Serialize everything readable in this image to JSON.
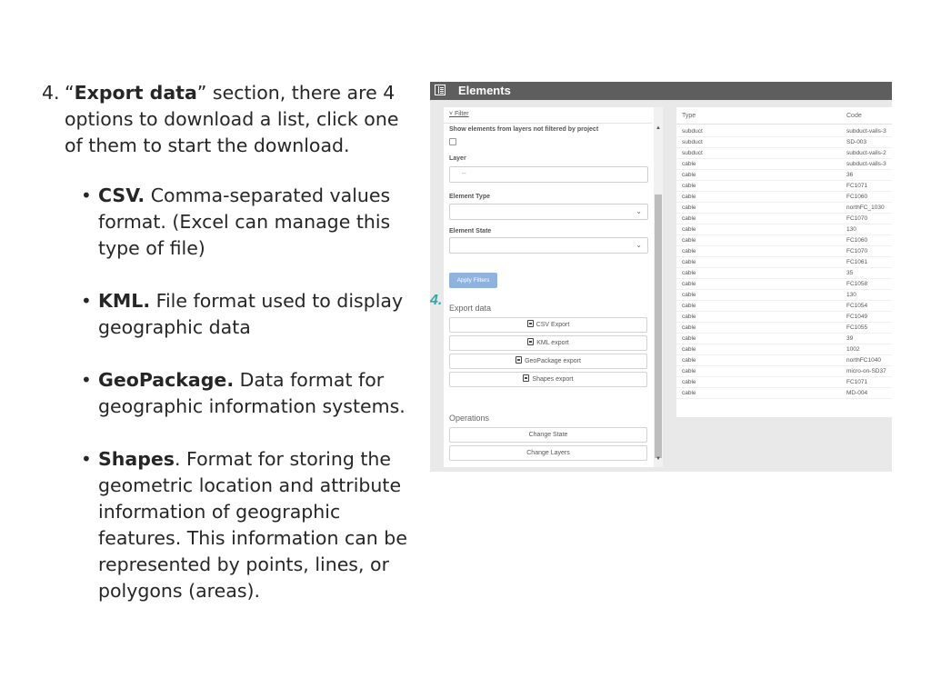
{
  "doc": {
    "step_number": "4.",
    "intro_open_quote": "“",
    "intro_bold": "Export data",
    "intro_rest": "” section, there are 4 options to download a list, click one of them to start the download.",
    "bullets": [
      {
        "term": "CSV.",
        "text": " Comma-separated values format. (Excel can manage this type of file)"
      },
      {
        "term": "KML.",
        "text": " File format used to display geographic data"
      },
      {
        "term": "GeoPackage.",
        "text": " Data format for geographic information systems."
      },
      {
        "term": "Shapes",
        "text": ". Format for storing the geometric location and attribute information of geographic features. This information can be represented by points, lines, or polygons (areas)."
      }
    ]
  },
  "screenshot": {
    "title": "Elements",
    "marker": "4.",
    "filter": {
      "toggle_label": "˅ Filter",
      "show_elements_label": "Show elements from layers not filtered by project",
      "layer_label": "Layer",
      "layer_placeholder": "--",
      "element_type_label": "Element Type",
      "element_state_label": "Element State",
      "apply_button": "Apply Filters",
      "export_title": "Export data",
      "exports": [
        "CSV Export",
        "KML export",
        "GeoPackage export",
        "Shapes export"
      ],
      "operations_title": "Operations",
      "operations": [
        "Change State",
        "Change Layers"
      ]
    },
    "table": {
      "columns": [
        "Type",
        "Code"
      ],
      "rows": [
        [
          "subduct",
          "subduct-valls-3"
        ],
        [
          "subduct",
          "SD-003"
        ],
        [
          "subduct",
          "subduct-valls-2"
        ],
        [
          "cable",
          "subduct-valls-3"
        ],
        [
          "cable",
          "36"
        ],
        [
          "cable",
          "FC1071"
        ],
        [
          "cable",
          "FC1060"
        ],
        [
          "cable",
          "northFC_1030"
        ],
        [
          "cable",
          "FC1070"
        ],
        [
          "cable",
          "130"
        ],
        [
          "cable",
          "FC1060"
        ],
        [
          "cable",
          "FC1070"
        ],
        [
          "cable",
          "FC1061"
        ],
        [
          "cable",
          "35"
        ],
        [
          "cable",
          "FC1058"
        ],
        [
          "cable",
          "130"
        ],
        [
          "cable",
          "FC1054"
        ],
        [
          "cable",
          "FC1049"
        ],
        [
          "cable",
          "FC1055"
        ],
        [
          "cable",
          "39"
        ],
        [
          "cable",
          "1002"
        ],
        [
          "cable",
          "northFC1040"
        ],
        [
          "cable",
          "micro-on-SD37"
        ],
        [
          "cable",
          "FC1071"
        ],
        [
          "cable",
          "MD-004"
        ]
      ]
    }
  }
}
